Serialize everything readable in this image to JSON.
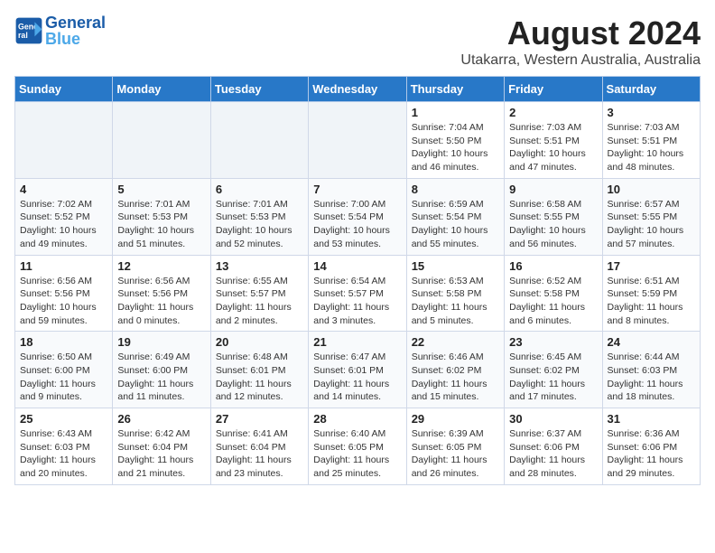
{
  "header": {
    "logo_general": "General",
    "logo_blue": "Blue",
    "month_year": "August 2024",
    "location": "Utakarra, Western Australia, Australia"
  },
  "days_of_week": [
    "Sunday",
    "Monday",
    "Tuesday",
    "Wednesday",
    "Thursday",
    "Friday",
    "Saturday"
  ],
  "weeks": [
    [
      {
        "day": "",
        "info": ""
      },
      {
        "day": "",
        "info": ""
      },
      {
        "day": "",
        "info": ""
      },
      {
        "day": "",
        "info": ""
      },
      {
        "day": "1",
        "info": "Sunrise: 7:04 AM\nSunset: 5:50 PM\nDaylight: 10 hours\nand 46 minutes."
      },
      {
        "day": "2",
        "info": "Sunrise: 7:03 AM\nSunset: 5:51 PM\nDaylight: 10 hours\nand 47 minutes."
      },
      {
        "day": "3",
        "info": "Sunrise: 7:03 AM\nSunset: 5:51 PM\nDaylight: 10 hours\nand 48 minutes."
      }
    ],
    [
      {
        "day": "4",
        "info": "Sunrise: 7:02 AM\nSunset: 5:52 PM\nDaylight: 10 hours\nand 49 minutes."
      },
      {
        "day": "5",
        "info": "Sunrise: 7:01 AM\nSunset: 5:53 PM\nDaylight: 10 hours\nand 51 minutes."
      },
      {
        "day": "6",
        "info": "Sunrise: 7:01 AM\nSunset: 5:53 PM\nDaylight: 10 hours\nand 52 minutes."
      },
      {
        "day": "7",
        "info": "Sunrise: 7:00 AM\nSunset: 5:54 PM\nDaylight: 10 hours\nand 53 minutes."
      },
      {
        "day": "8",
        "info": "Sunrise: 6:59 AM\nSunset: 5:54 PM\nDaylight: 10 hours\nand 55 minutes."
      },
      {
        "day": "9",
        "info": "Sunrise: 6:58 AM\nSunset: 5:55 PM\nDaylight: 10 hours\nand 56 minutes."
      },
      {
        "day": "10",
        "info": "Sunrise: 6:57 AM\nSunset: 5:55 PM\nDaylight: 10 hours\nand 57 minutes."
      }
    ],
    [
      {
        "day": "11",
        "info": "Sunrise: 6:56 AM\nSunset: 5:56 PM\nDaylight: 10 hours\nand 59 minutes."
      },
      {
        "day": "12",
        "info": "Sunrise: 6:56 AM\nSunset: 5:56 PM\nDaylight: 11 hours\nand 0 minutes."
      },
      {
        "day": "13",
        "info": "Sunrise: 6:55 AM\nSunset: 5:57 PM\nDaylight: 11 hours\nand 2 minutes."
      },
      {
        "day": "14",
        "info": "Sunrise: 6:54 AM\nSunset: 5:57 PM\nDaylight: 11 hours\nand 3 minutes."
      },
      {
        "day": "15",
        "info": "Sunrise: 6:53 AM\nSunset: 5:58 PM\nDaylight: 11 hours\nand 5 minutes."
      },
      {
        "day": "16",
        "info": "Sunrise: 6:52 AM\nSunset: 5:58 PM\nDaylight: 11 hours\nand 6 minutes."
      },
      {
        "day": "17",
        "info": "Sunrise: 6:51 AM\nSunset: 5:59 PM\nDaylight: 11 hours\nand 8 minutes."
      }
    ],
    [
      {
        "day": "18",
        "info": "Sunrise: 6:50 AM\nSunset: 6:00 PM\nDaylight: 11 hours\nand 9 minutes."
      },
      {
        "day": "19",
        "info": "Sunrise: 6:49 AM\nSunset: 6:00 PM\nDaylight: 11 hours\nand 11 minutes."
      },
      {
        "day": "20",
        "info": "Sunrise: 6:48 AM\nSunset: 6:01 PM\nDaylight: 11 hours\nand 12 minutes."
      },
      {
        "day": "21",
        "info": "Sunrise: 6:47 AM\nSunset: 6:01 PM\nDaylight: 11 hours\nand 14 minutes."
      },
      {
        "day": "22",
        "info": "Sunrise: 6:46 AM\nSunset: 6:02 PM\nDaylight: 11 hours\nand 15 minutes."
      },
      {
        "day": "23",
        "info": "Sunrise: 6:45 AM\nSunset: 6:02 PM\nDaylight: 11 hours\nand 17 minutes."
      },
      {
        "day": "24",
        "info": "Sunrise: 6:44 AM\nSunset: 6:03 PM\nDaylight: 11 hours\nand 18 minutes."
      }
    ],
    [
      {
        "day": "25",
        "info": "Sunrise: 6:43 AM\nSunset: 6:03 PM\nDaylight: 11 hours\nand 20 minutes."
      },
      {
        "day": "26",
        "info": "Sunrise: 6:42 AM\nSunset: 6:04 PM\nDaylight: 11 hours\nand 21 minutes."
      },
      {
        "day": "27",
        "info": "Sunrise: 6:41 AM\nSunset: 6:04 PM\nDaylight: 11 hours\nand 23 minutes."
      },
      {
        "day": "28",
        "info": "Sunrise: 6:40 AM\nSunset: 6:05 PM\nDaylight: 11 hours\nand 25 minutes."
      },
      {
        "day": "29",
        "info": "Sunrise: 6:39 AM\nSunset: 6:05 PM\nDaylight: 11 hours\nand 26 minutes."
      },
      {
        "day": "30",
        "info": "Sunrise: 6:37 AM\nSunset: 6:06 PM\nDaylight: 11 hours\nand 28 minutes."
      },
      {
        "day": "31",
        "info": "Sunrise: 6:36 AM\nSunset: 6:06 PM\nDaylight: 11 hours\nand 29 minutes."
      }
    ]
  ]
}
